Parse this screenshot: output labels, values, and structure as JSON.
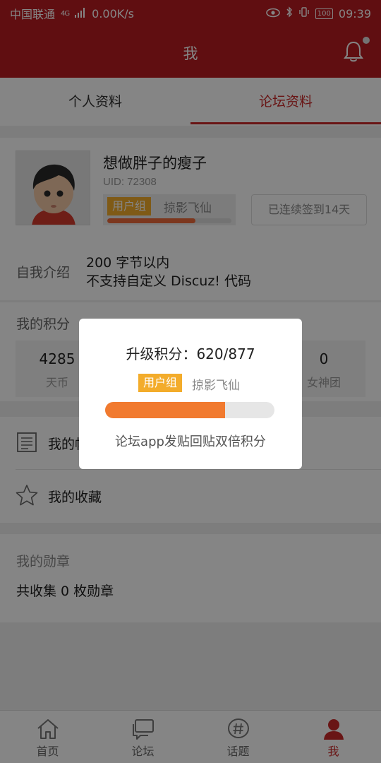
{
  "status_bar": {
    "carrier": "中国联通",
    "network": "4G",
    "speed": "0.00K/s",
    "battery": "100",
    "time": "09:39"
  },
  "app_bar": {
    "title": "我",
    "icon": "bell-icon"
  },
  "tabs": [
    {
      "label": "个人资料",
      "active": false
    },
    {
      "label": "论坛资料",
      "active": true
    }
  ],
  "profile": {
    "username": "想做胖子的瘦子",
    "uid": "UID: 72308",
    "group_badge": "用户组",
    "group_name": "掠影飞仙",
    "group_progress": 0.71,
    "checkin": "已连续签到14天",
    "intro_label": "自我介绍",
    "intro_line1": "200 字节以内",
    "intro_line2": "不支持自定义 Discuz! 代码"
  },
  "points": {
    "label": "我的积分",
    "stats": [
      {
        "value": "4285",
        "label": "天币"
      },
      {
        "value": "0",
        "label": "女神团"
      }
    ]
  },
  "menu": [
    {
      "label": "我的帖子",
      "icon": "document-icon"
    },
    {
      "label": "我的收藏",
      "icon": "star-icon"
    }
  ],
  "medals": {
    "title": "我的勋章",
    "summary": "共收集 0 枚勋章"
  },
  "bottom_nav": [
    {
      "label": "首页",
      "icon": "home-icon",
      "active": false
    },
    {
      "label": "论坛",
      "icon": "forum-icon",
      "active": false
    },
    {
      "label": "话题",
      "icon": "hashtag-icon",
      "active": false
    },
    {
      "label": "我",
      "icon": "user-icon",
      "active": true
    }
  ],
  "dialog": {
    "title": "升级积分：620/877",
    "badge": "用户组",
    "group_name": "掠影飞仙",
    "progress_current": 620,
    "progress_total": 877,
    "tip": "论坛app发贴回贴双倍积分"
  },
  "colors": {
    "brand": "#b81c22",
    "accent": "#c92a2a",
    "badge": "#f3ac2b",
    "progress": "#f17a2f"
  }
}
